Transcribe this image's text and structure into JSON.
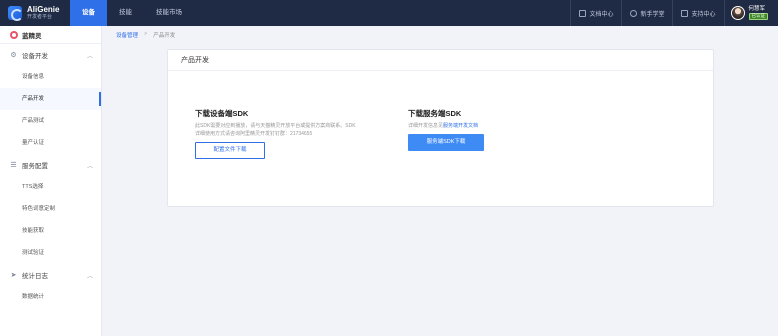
{
  "topbar": {
    "logo_title": "AliGenie",
    "logo_sub": "开发者平台",
    "nav": [
      {
        "label": "设备"
      },
      {
        "label": "技能"
      },
      {
        "label": "技能市场"
      }
    ],
    "right": [
      {
        "label": "文档中心"
      },
      {
        "label": "新手学堂"
      },
      {
        "label": "支持中心"
      }
    ],
    "user_name": "何慧军",
    "user_badge": "已认证"
  },
  "sidebar": {
    "brand": "蓝精灵",
    "groups": [
      {
        "label": "设备开发",
        "items": [
          "设备信息",
          "产品开发",
          "产品测试",
          "量产认证"
        ]
      },
      {
        "label": "服务配置",
        "items": [
          "TTS选择",
          "特色词意定制",
          "技能获取",
          "测试验证"
        ]
      },
      {
        "label": "统计日志",
        "items": [
          "数据统计"
        ]
      }
    ]
  },
  "breadcrumb": {
    "root": "设备管理",
    "sep": ">",
    "current": "产品开发"
  },
  "card": {
    "title": "产品开发",
    "left": {
      "title": "下载设备端SDK",
      "desc": "此SDK需要对应到播放，请与天猫精灵开放平台或提供方案商联系。SDK详细使用方式请咨询阿里精灵开发钉钉群：21734655",
      "button": "配置文件下载"
    },
    "right": {
      "title": "下载服务端SDK",
      "desc_prefix": "详细开发信息见",
      "desc_link": "服务端开发文档",
      "button": "服务端SDK下载"
    }
  },
  "colors": {
    "topbar_bg": "#1f2a44",
    "accent": "#2f6fe8",
    "button_fill": "#3e8bf6"
  }
}
